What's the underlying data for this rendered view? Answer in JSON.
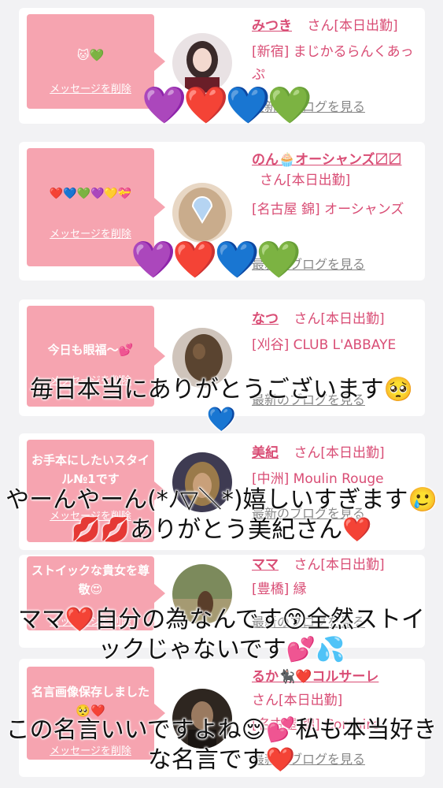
{
  "delete_label": "メッセージを削除",
  "blog_label": "最新のブログを見る",
  "honorific": "さん[本日出勤]",
  "hearts": "💜❤️💙💚",
  "cards": [
    {
      "message": "🐱💚",
      "name": "みつき",
      "shop": "[新宿] まじかるらんくあっぷ",
      "avatar_colors": [
        "#e9e2e4",
        "#3a2a2a"
      ]
    },
    {
      "message": "❤️💙💚💜💛💝",
      "name": "のん🧁オーシャンズ〼〼",
      "shop": "[名古屋 錦] オーシャンズ",
      "avatar_colors": [
        "#e8d7c4",
        "#b69a80"
      ]
    },
    {
      "message": "今日も眼福〜💕",
      "name": "なつ",
      "shop": "[刈谷] CLUB L'ABBAYE",
      "avatar_colors": [
        "#cfc4bb",
        "#5a4430"
      ]
    },
    {
      "message": "お手本にしたいスタイル№1です",
      "name": "美紀",
      "shop": "[中洲] Moulin Rouge",
      "avatar_colors": [
        "#3e3b52",
        "#9a7a4a"
      ]
    },
    {
      "message": "ストイックな貴女を尊敬😍",
      "name": "ママ",
      "shop": "[豊橋] 縁",
      "avatar_colors": [
        "#7c8a5c",
        "#c9c2a8"
      ]
    },
    {
      "message": "名言画像保存しました🥺❤️",
      "name": "るか🐈‍⬛❤️コルサーレ",
      "shop": "[名古屋 錦] Corsaire",
      "avatar_colors": [
        "#2e2620",
        "#9a7a60"
      ]
    }
  ],
  "overlay_texts": [
    "毎日本当にありがとうございます🥺💙",
    "やーんやーん(*ﾉ▽＼*)嬉しいすぎます🥲💋💋ありがとう美紀さん❤️",
    "ママ❤️自分の為なんです😙全然ストイックじゃないです💕💦",
    "この名言いいですよね😌💕私も本当好きな名言です❤️"
  ]
}
